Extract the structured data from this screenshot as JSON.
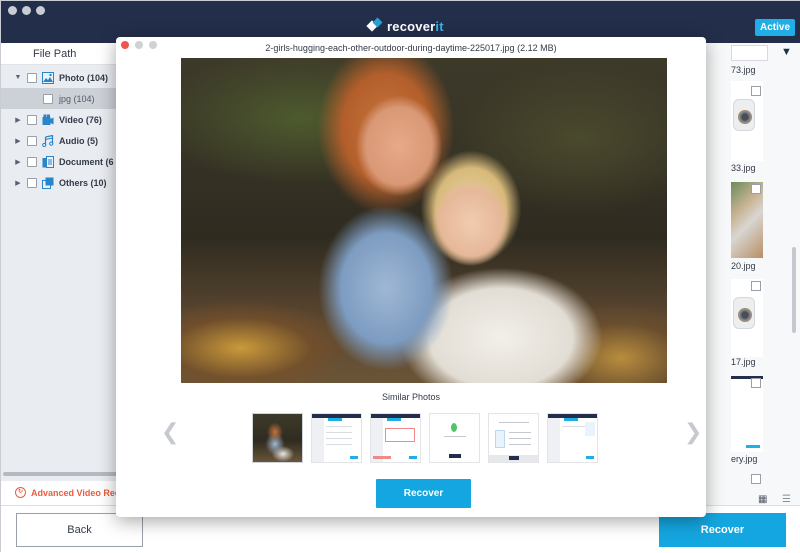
{
  "app": {
    "brand_prefix": "recover",
    "brand_suffix": "it",
    "status_badge": "Active",
    "colors": {
      "titlebar": "#232e4a",
      "accent": "#14a6e0",
      "warning": "#ec5b3d"
    }
  },
  "sidebar": {
    "header": "File Path",
    "items": [
      {
        "label": "Photo (104)",
        "icon": "photo-icon",
        "expanded": true
      },
      {
        "label": "jpg (104)",
        "icon": "",
        "sub": true,
        "selected": true
      },
      {
        "label": "Video (76)",
        "icon": "video-icon",
        "expanded": false
      },
      {
        "label": "Audio (5)",
        "icon": "audio-icon",
        "expanded": false
      },
      {
        "label": "Document (6",
        "icon": "document-icon",
        "expanded": false
      },
      {
        "label": "Others (10)",
        "icon": "others-icon",
        "expanded": false
      }
    ],
    "advanced_label": "Advanced Video Rec"
  },
  "right_panel": {
    "files": [
      {
        "name": "73.jpg"
      },
      {
        "name": "33.jpg"
      },
      {
        "name": "20.jpg"
      },
      {
        "name": "17.jpg"
      },
      {
        "name": "ery.jpg"
      }
    ]
  },
  "modal": {
    "title": "2-girls-hugging-each-other-outdoor-during-daytime-225017.jpg (2.12 MB)",
    "similar_label": "Similar Photos",
    "recover_label": "Recover",
    "similar_count": 6
  },
  "footer": {
    "back_label": "Back",
    "recover_label": "Recover"
  }
}
